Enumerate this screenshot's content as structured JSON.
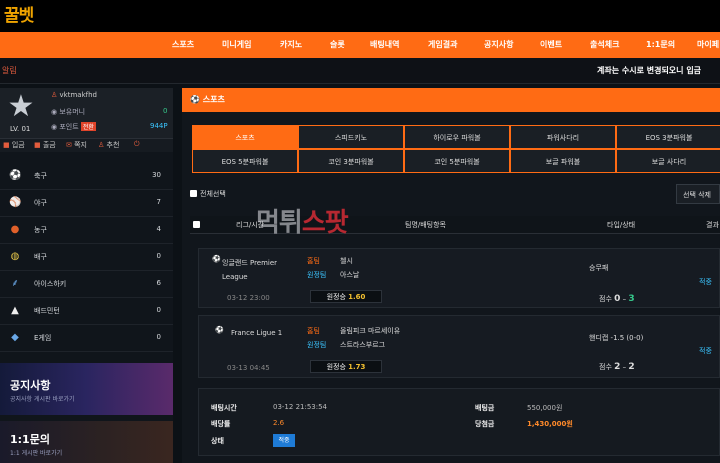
{
  "logo": {
    "text": "꿀벳"
  },
  "nav": {
    "items": [
      "스포츠",
      "미니게임",
      "카지노",
      "슬롯",
      "배팅내역",
      "게임결과",
      "공지사항",
      "이벤트",
      "출석체크",
      "1:1문의",
      "마이페"
    ]
  },
  "notice": {
    "tag": "알림",
    "text": "계좌는 수시로 변경되오니 입금"
  },
  "sidebar": {
    "profile": {
      "username": "vktmakfhd",
      "level": "LV. 01",
      "bonus_label": "보유머니",
      "bonus_value": "0",
      "point_label": "포인트",
      "point_badge": "전환",
      "point_value": "944P"
    },
    "quick": [
      "입금",
      "출금",
      "쪽지",
      "추천",
      "⏻"
    ],
    "sports": [
      {
        "icon": "soccer-icon",
        "name": "축구",
        "count": "30"
      },
      {
        "icon": "baseball-icon",
        "name": "야구",
        "count": "7"
      },
      {
        "icon": "basketball-icon",
        "name": "농구",
        "count": "4"
      },
      {
        "icon": "volleyball-icon",
        "name": "배구",
        "count": "0"
      },
      {
        "icon": "hockey-icon",
        "name": "아이스하키",
        "count": "6"
      },
      {
        "icon": "badminton-icon",
        "name": "배드민턴",
        "count": "0"
      },
      {
        "icon": "esports-icon",
        "name": "E게임",
        "count": "0"
      }
    ],
    "banners": [
      {
        "title": "공지사항",
        "subtitle": "공지사항 게시판 바로가기"
      },
      {
        "title": "1:1문의",
        "subtitle": "1:1 게시판 바로가기"
      }
    ]
  },
  "main": {
    "title": "스포츠",
    "tabs_row1": [
      "스포츠",
      "스피드키노",
      "하이로우 파워볼",
      "파워사다리",
      "EOS 3분파워볼"
    ],
    "tabs_row2": [
      "EOS 5분파워볼",
      "코인 3분파워볼",
      "코인 5분파워볼",
      "보글 파워볼",
      "보글 사다리"
    ],
    "select_all": "전체선택",
    "delete_button": "선택 삭제",
    "headers": [
      "리그/시간",
      "팀명/배팅항목",
      "타입/상태",
      "결과"
    ],
    "watermark": {
      "part1": "먹튀",
      "part2": "스팟"
    },
    "matches": [
      {
        "league": "잉글랜드 Premier League",
        "time": "03-12 23:00",
        "home_tag": "홈팀",
        "home": "첼시",
        "away_tag": "원정팀",
        "away": "아스날",
        "pick_label": "원정승",
        "pick_odds": "1.60",
        "type": "승무패",
        "score_label": "점수",
        "score_home": "0",
        "score_away": "3",
        "result": "적중"
      },
      {
        "league": "France Ligue 1",
        "time": "03-13 04:45",
        "home_tag": "홈팀",
        "home": "올림피크 마르세이유",
        "away_tag": "원정팀",
        "away": "스트라스부르그",
        "type": "핸디캡 -1.5 (0-0)",
        "pick_label": "원정승",
        "pick_odds": "1.73",
        "score_label": "점수",
        "score_home": "2",
        "score_away": "2",
        "result": "적중"
      }
    ],
    "summary": {
      "bet_time_label": "배팅시간",
      "bet_time": "03-12 21:53:54",
      "odds_label": "배당률",
      "odds": "2.6",
      "status_label": "상태",
      "status": "적중",
      "amount_label": "배팅금",
      "amount": "550,000원",
      "win_label": "당첨금",
      "win": "1,430,000원"
    }
  }
}
